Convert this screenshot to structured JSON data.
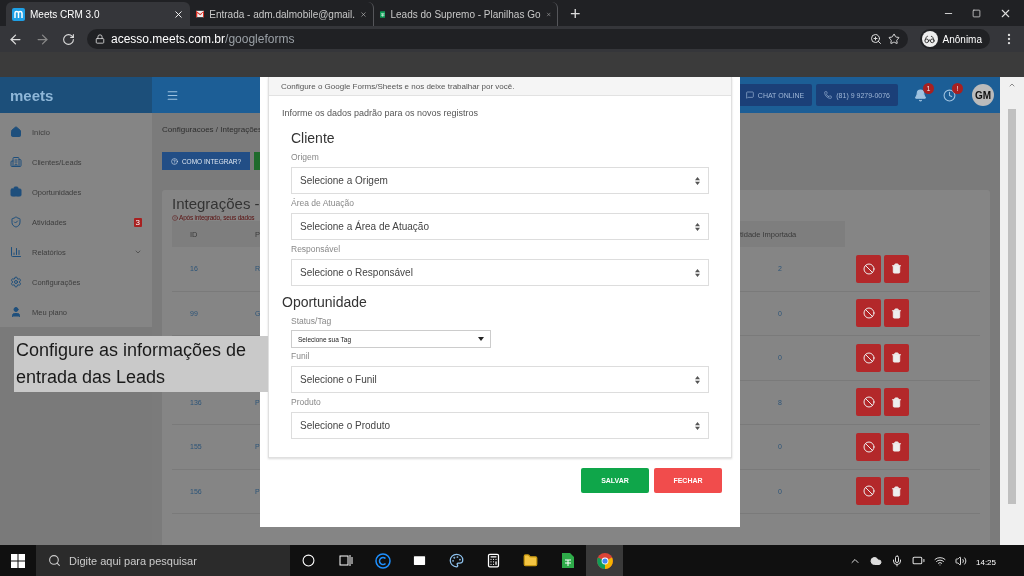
{
  "browser": {
    "tabs": [
      {
        "title": "Meets CRM 3.0",
        "selected": true
      },
      {
        "title": "Entrada - adm.dalmobile@gmail.",
        "selected": false
      },
      {
        "title": "Leads do Supremo - Planilhas Go",
        "selected": false
      }
    ],
    "new_tab": "+",
    "url_host": "acesso.meets.com.br",
    "url_path": "/googleforms",
    "profile": "Anônima"
  },
  "app": {
    "logo": "meets",
    "header": {
      "chat_button": "CHAT ONLINE",
      "phone_button": "(81) 9 9279-0076",
      "notification_badge": "1",
      "alert_badge": "!",
      "avatar": "GM"
    },
    "sidebar": {
      "items": [
        {
          "label": "Início"
        },
        {
          "label": "Clientes/Leads"
        },
        {
          "label": "Oportunidades"
        },
        {
          "label": "Atividades",
          "badge": "3"
        },
        {
          "label": "Relatórios",
          "expandable": true
        },
        {
          "label": "Configurações"
        },
        {
          "label": "Meu plano"
        }
      ]
    },
    "breadcrumb": "Configuracoes / Integrações",
    "help_button": "COMO INTEGRAR?",
    "panel": {
      "title": "Integrações -",
      "note": "Após integrado, seus dados",
      "columns": [
        "ID",
        "P",
        "tidade Importada"
      ],
      "rows": [
        {
          "id": "16",
          "column_2": "R",
          "quantity": "2"
        },
        {
          "id": "99",
          "column_2": "G",
          "quantity": "0"
        },
        {
          "quantity": "0"
        },
        {
          "id": "136",
          "column_2": "P",
          "quantity": "8"
        },
        {
          "id": "155",
          "column_2": "P",
          "quantity": "0"
        },
        {
          "id": "156",
          "column_2": "P",
          "quantity": "0"
        }
      ]
    }
  },
  "modal": {
    "subtitle": "Configure o Google Forms/Sheets e nos deixe trabalhar por você.",
    "intro": "Informe os dados padrão para os novos registros",
    "sections": [
      {
        "title": "Cliente",
        "fields": [
          {
            "label": "Origem",
            "value": "Selecione a Origem",
            "kind": "select"
          },
          {
            "label": "Área de Atuação",
            "value": "Selecione a Área de Atuação",
            "kind": "select"
          },
          {
            "label": "Responsável",
            "value": "Selecione o Responsável",
            "kind": "select"
          }
        ]
      },
      {
        "title": "Oportunidade",
        "fields": [
          {
            "label": "Status/Tag",
            "value": "Selecione sua Tag",
            "kind": "dropdown"
          },
          {
            "label": "Funil",
            "value": "Selecione o Funil",
            "kind": "select"
          },
          {
            "label": "Produto",
            "value": "Selecione o Produto",
            "kind": "select"
          }
        ]
      }
    ],
    "buttons": [
      {
        "label": "SALVAR",
        "kind": "primary"
      },
      {
        "label": "FECHAR",
        "kind": "danger"
      }
    ]
  },
  "caption": "Configure as informações de entrada das Leads",
  "taskbar": {
    "search_placeholder": "Digite aqui para pesquisar",
    "time": "14:25"
  }
}
